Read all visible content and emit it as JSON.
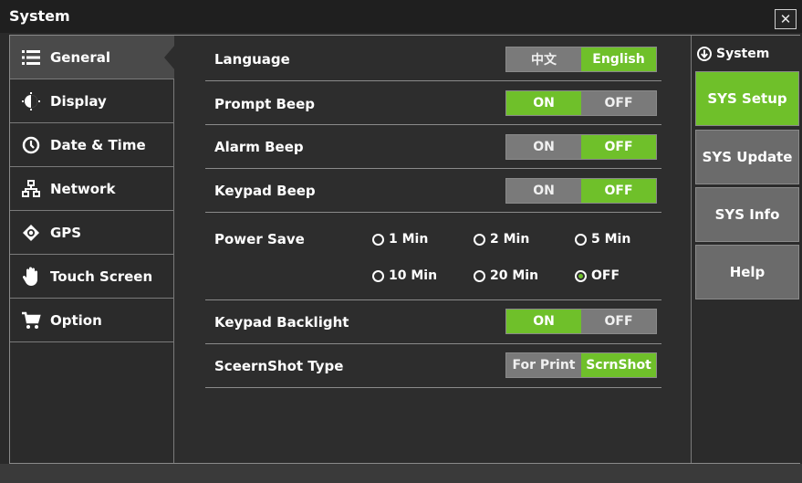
{
  "window": {
    "title": "System",
    "close_glyph": "✕"
  },
  "sidebar": {
    "items": [
      {
        "label": "General",
        "icon": "list-icon",
        "active": true
      },
      {
        "label": "Display",
        "icon": "brightness-icon",
        "active": false
      },
      {
        "label": "Date & Time",
        "icon": "clock-icon",
        "active": false
      },
      {
        "label": "Network",
        "icon": "network-icon",
        "active": false
      },
      {
        "label": "GPS",
        "icon": "gps-icon",
        "active": false
      },
      {
        "label": "Touch Screen",
        "icon": "hand-icon",
        "active": false
      },
      {
        "label": "Option",
        "icon": "cart-icon",
        "active": false
      }
    ]
  },
  "settings": {
    "language": {
      "label": "Language",
      "options": [
        "中文",
        "English"
      ],
      "selected": "English"
    },
    "prompt_beep": {
      "label": "Prompt Beep",
      "options": [
        "ON",
        "OFF"
      ],
      "selected": "ON"
    },
    "alarm_beep": {
      "label": "Alarm Beep",
      "options": [
        "ON",
        "OFF"
      ],
      "selected": "OFF"
    },
    "keypad_beep": {
      "label": "Keypad Beep",
      "options": [
        "ON",
        "OFF"
      ],
      "selected": "OFF"
    },
    "power_save": {
      "label": "Power Save",
      "options": [
        "1 Min",
        "2 Min",
        "5 Min",
        "10 Min",
        "20 Min",
        "OFF"
      ],
      "selected": "OFF"
    },
    "keypad_backlight": {
      "label": "Keypad Backlight",
      "options": [
        "ON",
        "OFF"
      ],
      "selected": "ON"
    },
    "screenshot_type": {
      "label": "SceernShot Type",
      "options": [
        "For Print",
        "ScrnShot"
      ],
      "selected": "ScrnShot"
    }
  },
  "right_panel": {
    "header": "System",
    "header_icon": "circle-down-arrow-icon",
    "buttons": [
      {
        "label": "SYS Setup",
        "active": true
      },
      {
        "label": "SYS Update",
        "active": false
      },
      {
        "label": "SYS Info",
        "active": false
      },
      {
        "label": "Help",
        "active": false
      }
    ]
  },
  "colors": {
    "accent": "#6fc02a",
    "inactive": "#7a7a7a",
    "background": "#2d2d2d"
  }
}
